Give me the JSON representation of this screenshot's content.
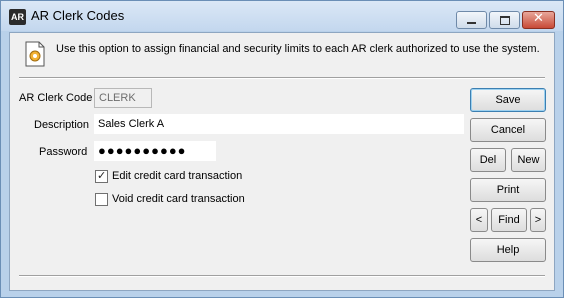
{
  "window": {
    "title": "AR Clerk Codes",
    "app_icon_text": "AR",
    "controls": {
      "close_glyph": "✕"
    }
  },
  "info": {
    "text": "Use this option to assign financial and security limits to each AR clerk authorized to use the system."
  },
  "form": {
    "clerk_code_label": "AR Clerk Code",
    "clerk_code_value": "CLERK",
    "description_label": "Description",
    "description_value": "Sales Clerk A",
    "password_label": "Password",
    "password_value": "●●●●●●●●●●",
    "edit_cc_label": "Edit credit card transaction",
    "edit_cc_checked": true,
    "void_cc_label": "Void credit card transaction",
    "void_cc_checked": false
  },
  "buttons": {
    "save": "Save",
    "cancel": "Cancel",
    "del": "Del",
    "new": "New",
    "print": "Print",
    "prev": "<",
    "find": "Find",
    "next": ">",
    "help": "Help"
  },
  "checkmark": "✓"
}
